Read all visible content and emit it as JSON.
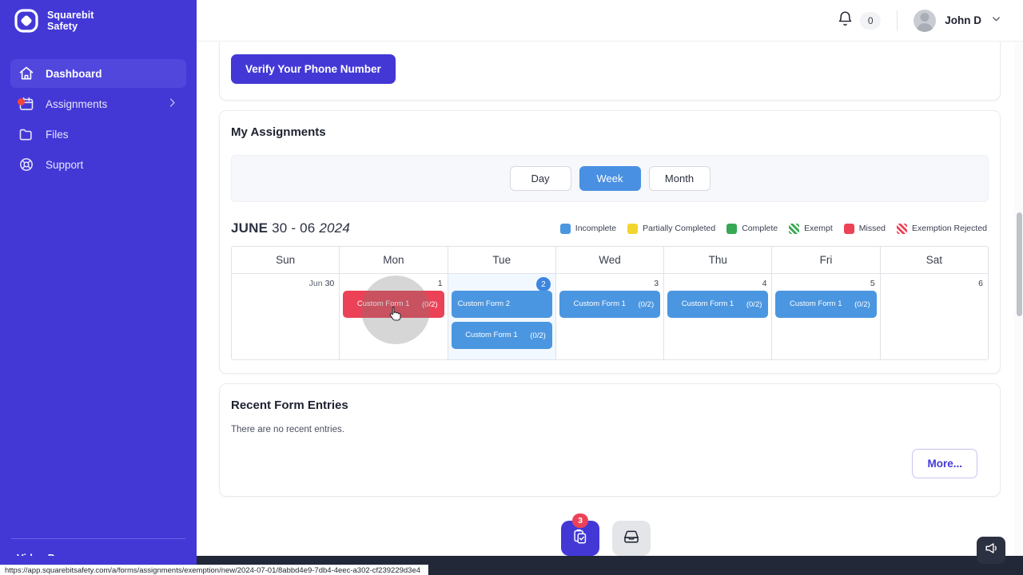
{
  "brand": {
    "line1": "Squarebit",
    "line2": "Safety",
    "icon": "squarebit-logo-icon"
  },
  "sidebar": {
    "items": [
      {
        "label": "Dashboard",
        "icon": "home-icon",
        "active": true,
        "dot": false,
        "chevron": false
      },
      {
        "label": "Assignments",
        "icon": "calendar-icon",
        "active": false,
        "dot": true,
        "chevron": true
      },
      {
        "label": "Files",
        "icon": "folder-icon",
        "active": false,
        "dot": false,
        "chevron": false
      },
      {
        "label": "Support",
        "icon": "lifebuoy-icon",
        "active": false,
        "dot": false,
        "chevron": false
      }
    ],
    "footer_link": "Video Demo"
  },
  "topbar": {
    "bell_icon": "bell-icon",
    "notification_count": "0",
    "user_name": "John D",
    "chevron_icon": "chevron-down-icon",
    "avatar_icon": "user-avatar"
  },
  "verify": {
    "button_label": "Verify Your Phone Number"
  },
  "assignments": {
    "title": "My Assignments",
    "range_buttons": [
      {
        "label": "Day",
        "active": false
      },
      {
        "label": "Week",
        "active": true
      },
      {
        "label": "Month",
        "active": false
      }
    ],
    "range_month": "JUNE",
    "range_days": "30 - 06",
    "range_year": "2024",
    "legend": [
      {
        "label": "Incomplete",
        "color": "#4b96e0",
        "striped": false
      },
      {
        "label": "Partially Completed",
        "color": "#f2d52c",
        "striped": false
      },
      {
        "label": "Complete",
        "color": "#36a853",
        "striped": false
      },
      {
        "label": "Exempt",
        "color": "#36a853",
        "striped": true
      },
      {
        "label": "Missed",
        "color": "#ec4257",
        "striped": false
      },
      {
        "label": "Exemption Rejected",
        "color": "#ec4257",
        "striped": true
      }
    ],
    "day_names": [
      "Sun",
      "Mon",
      "Tue",
      "Wed",
      "Thu",
      "Fri",
      "Sat"
    ],
    "days": [
      {
        "prefix": "Jun",
        "number": "30",
        "today": false,
        "events": []
      },
      {
        "prefix": "",
        "number": "1",
        "today": false,
        "events": [
          {
            "name": "Custom Form 1",
            "count": "(0/2)",
            "status": "red"
          }
        ]
      },
      {
        "prefix": "",
        "number": "2",
        "today": true,
        "events": [
          {
            "name": "Custom Form 2",
            "count": "",
            "status": "blue"
          },
          {
            "name": "Custom Form 1",
            "count": "(0/2)",
            "status": "blue"
          }
        ]
      },
      {
        "prefix": "",
        "number": "3",
        "today": false,
        "events": [
          {
            "name": "Custom Form 1",
            "count": "(0/2)",
            "status": "blue"
          }
        ]
      },
      {
        "prefix": "",
        "number": "4",
        "today": false,
        "events": [
          {
            "name": "Custom Form 1",
            "count": "(0/2)",
            "status": "blue"
          }
        ]
      },
      {
        "prefix": "",
        "number": "5",
        "today": false,
        "events": [
          {
            "name": "Custom Form 1",
            "count": "(0/2)",
            "status": "blue"
          }
        ]
      },
      {
        "prefix": "",
        "number": "6",
        "today": false,
        "events": []
      }
    ]
  },
  "entries": {
    "title": "Recent Form Entries",
    "empty_text": "There are no recent entries.",
    "more_label": "More..."
  },
  "footer": {
    "fab_primary_icon": "clipboard-check-icon",
    "fab_primary_badge": "3",
    "fab_secondary_icon": "inbox-tray-icon",
    "chat_icon": "megaphone-icon"
  },
  "statusbar": {
    "url": "https://app.squarebitsafety.com/a/forms/assignments/exemption/new/2024-07-01/8abbd4e9-7db4-4eec-a302-cf239229d3e4"
  }
}
